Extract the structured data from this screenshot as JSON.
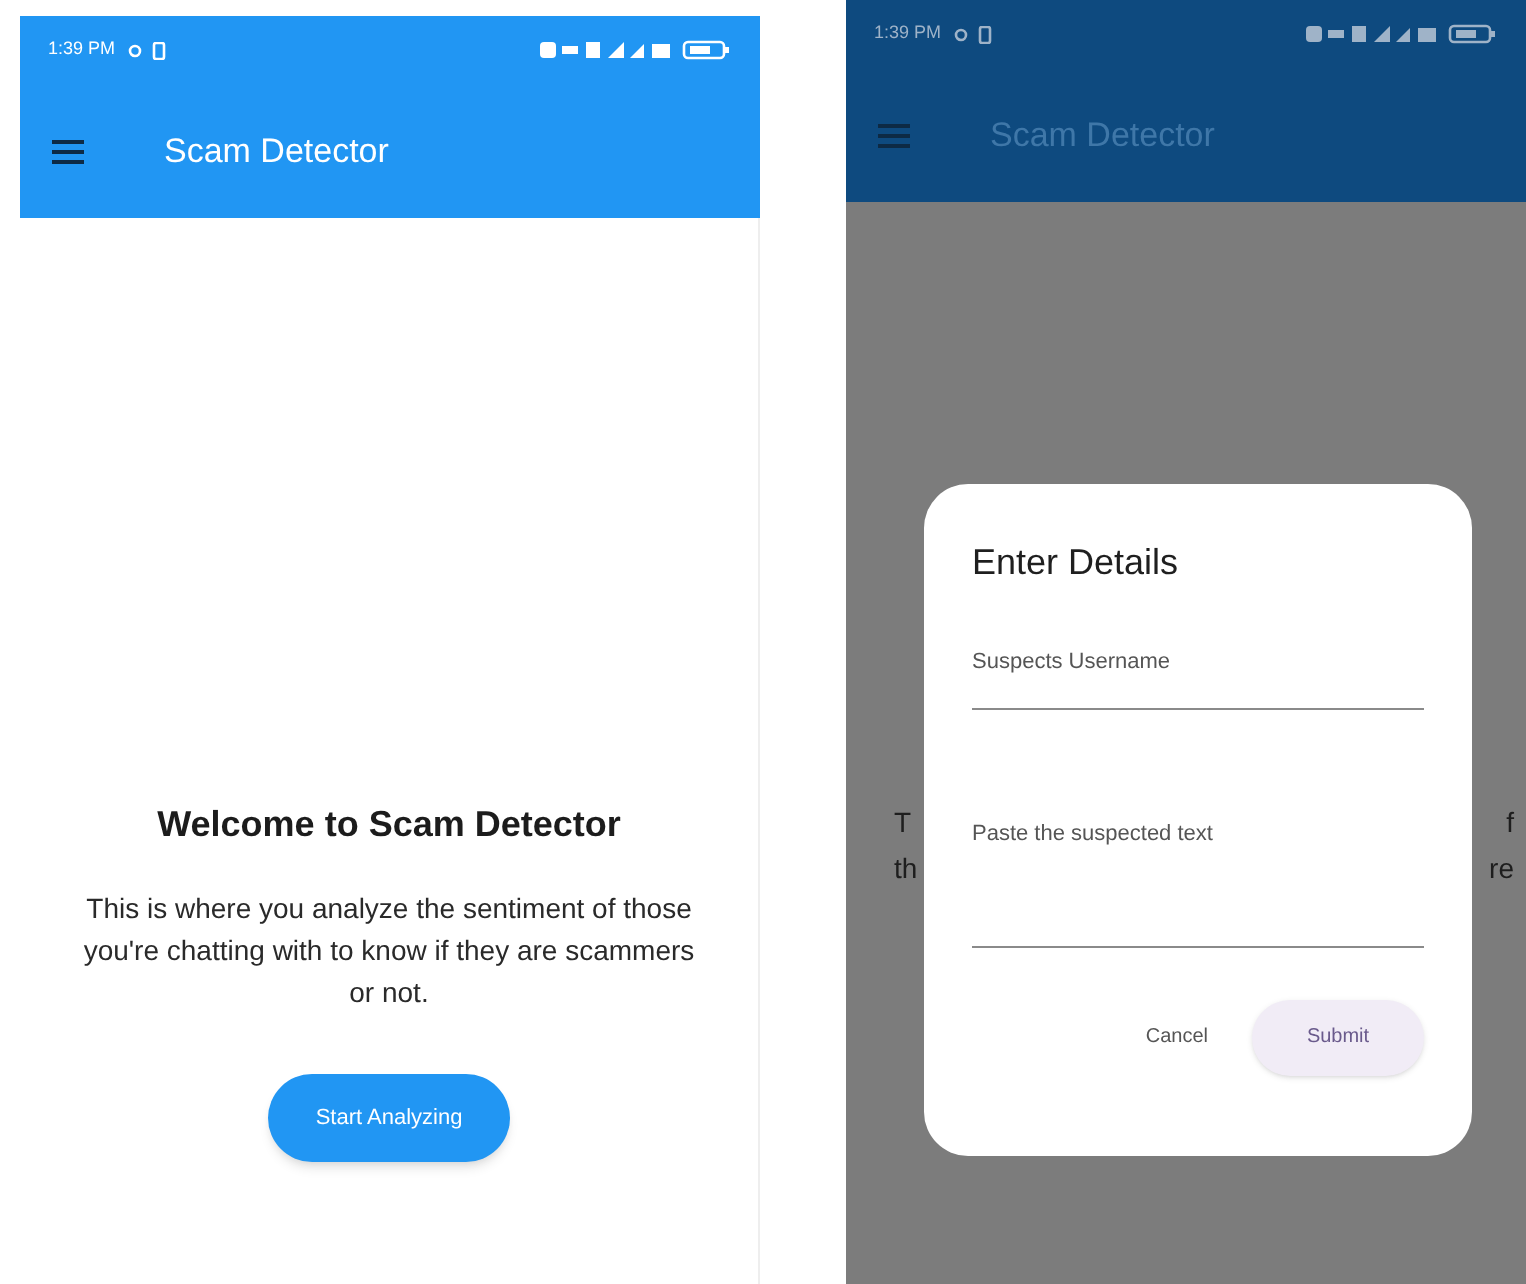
{
  "screens": [
    {
      "status_bar": {
        "time": "1:39 PM"
      },
      "app_bar": {
        "title": "Scam Detector"
      },
      "dimmed": false,
      "welcome": {
        "heading": "Welcome to Scam Detector",
        "body": "This is where you analyze the sentiment of those you're chatting with to know if they are scammers or not.",
        "button": "Start Analyzing"
      }
    },
    {
      "status_bar": {
        "time": "1:39 PM"
      },
      "app_bar": {
        "title": "Scam Detector"
      },
      "dimmed": true,
      "background_text_rows": [
        {
          "left": "T",
          "right": "f"
        },
        {
          "left": "th",
          "right": "re"
        }
      ],
      "dialog": {
        "title": "Enter Details",
        "fields": [
          {
            "placeholder": "Suspects Username",
            "kind": "single"
          },
          {
            "placeholder": "Paste the suspected text",
            "kind": "multi"
          }
        ],
        "buttons": [
          {
            "label": "Cancel",
            "kind": "text"
          },
          {
            "label": "Submit",
            "kind": "tonal"
          }
        ]
      }
    }
  ]
}
